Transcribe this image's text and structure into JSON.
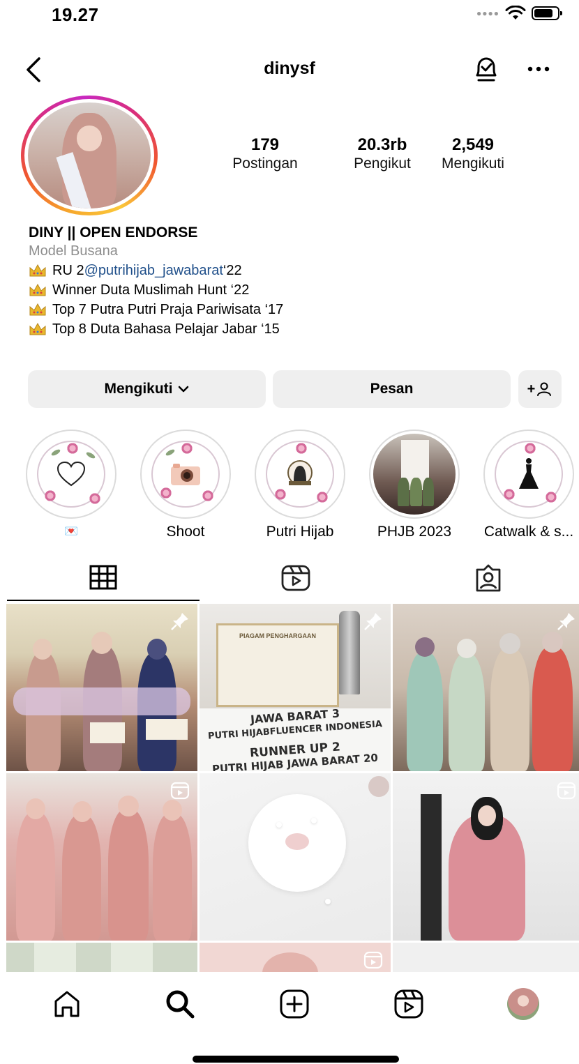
{
  "status_bar": {
    "time": "19.27"
  },
  "header": {
    "username": "dinysf"
  },
  "stats": [
    {
      "value": "179",
      "label": "Postingan"
    },
    {
      "value": "20.3rb",
      "label": "Pengikut"
    },
    {
      "value": "2,549",
      "label": "Mengikuti"
    }
  ],
  "bio": {
    "name": "DINY || OPEN ENDORSE",
    "category": "Model Busana",
    "lines": [
      {
        "prefix": "RU 2 ",
        "mention": "@putrihijab_jawabarat",
        "suffix": " ‘22"
      },
      {
        "text": "Winner Duta Muslimah Hunt ‘22"
      },
      {
        "text": "Top 7 Putra Putri Praja Pariwisata ‘17"
      },
      {
        "text": "Top 8 Duta Bahasa Pelajar Jabar ‘15"
      }
    ]
  },
  "actions": {
    "follow_label": "Mengikuti",
    "message_label": "Pesan",
    "add_label": "+"
  },
  "highlights": [
    {
      "label": "💌",
      "icon": "heart-icon"
    },
    {
      "label": "Shoot",
      "icon": "camera-icon"
    },
    {
      "label": "Putri Hijab",
      "icon": "hijab-logo-icon"
    },
    {
      "label": "PHJB 2023",
      "icon": "photo"
    },
    {
      "label": "Catwalk & s...",
      "icon": "dress-icon"
    }
  ],
  "tabs": [
    {
      "icon": "grid-icon",
      "active": true
    },
    {
      "icon": "reels-icon",
      "active": false
    },
    {
      "icon": "tagged-icon",
      "active": false
    }
  ],
  "posts": {
    "t1_cert_title": "PIAGAM PENGHARGAAN",
    "t1_sash_1": "JAWA BARAT 3",
    "t1_sash_2": "PUTRI HIJABFLUENCER INDONESIA",
    "t1_sash_3": "RUNNER UP 2",
    "t1_sash_4": "PUTRI HIJAB JAWA BARAT 20"
  },
  "colors": {
    "mention": "#1f4f8a",
    "button_bg": "#efefef",
    "secondary_text": "#8e8e8e"
  }
}
